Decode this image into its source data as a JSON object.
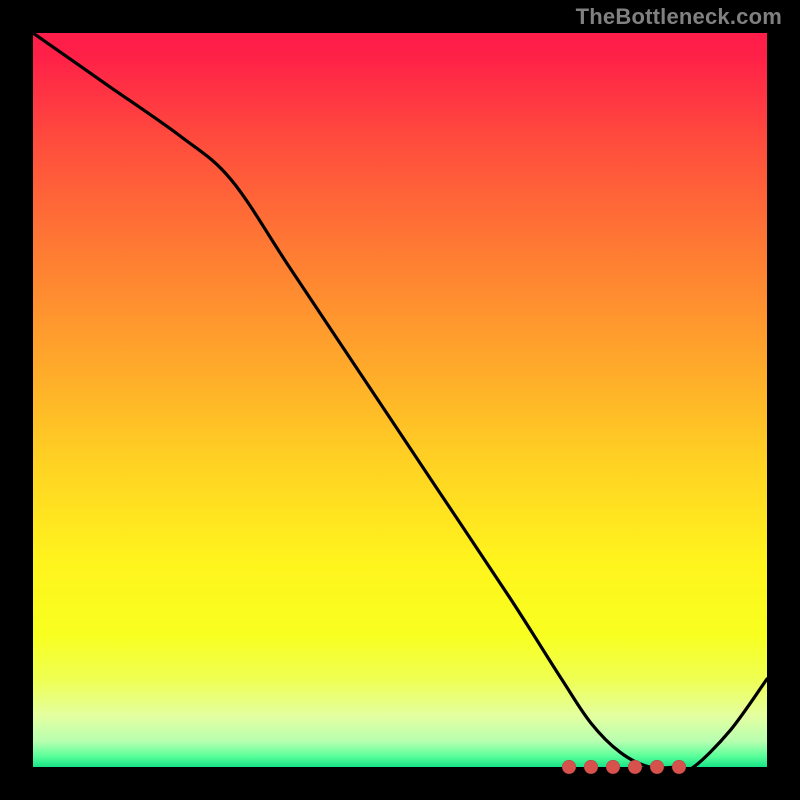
{
  "watermark": "TheBottleneck.com",
  "chart_data": {
    "type": "line",
    "title": "",
    "xlabel": "",
    "ylabel": "",
    "xlim": [
      0,
      100
    ],
    "ylim": [
      0,
      100
    ],
    "grid": false,
    "legend": false,
    "series": [
      {
        "name": "curve",
        "color": "#000000",
        "x": [
          0,
          10,
          20,
          27,
          35,
          45,
          55,
          65,
          72,
          76,
          80,
          84,
          88,
          90,
          95,
          100
        ],
        "y": [
          100,
          93,
          86,
          80,
          68,
          53,
          38,
          23,
          12,
          6,
          2,
          0,
          0,
          0,
          5,
          12
        ]
      }
    ],
    "optimal_markers_x": [
      73,
      76,
      79,
      82,
      85,
      88
    ],
    "optimal_markers_y": 0,
    "marker_color": "#d7524d",
    "gradient_stops": [
      {
        "offset": 0.0,
        "color": "#ff1d4a"
      },
      {
        "offset": 0.03,
        "color": "#ff2048"
      },
      {
        "offset": 0.15,
        "color": "#ff4d3d"
      },
      {
        "offset": 0.3,
        "color": "#ff7c33"
      },
      {
        "offset": 0.45,
        "color": "#ffa82b"
      },
      {
        "offset": 0.58,
        "color": "#ffd023"
      },
      {
        "offset": 0.72,
        "color": "#fff41d"
      },
      {
        "offset": 0.82,
        "color": "#f8ff20"
      },
      {
        "offset": 0.88,
        "color": "#efff52"
      },
      {
        "offset": 0.93,
        "color": "#e4ffa0"
      },
      {
        "offset": 0.965,
        "color": "#b8ffb0"
      },
      {
        "offset": 0.985,
        "color": "#5bff9a"
      },
      {
        "offset": 1.0,
        "color": "#16e386"
      }
    ]
  }
}
